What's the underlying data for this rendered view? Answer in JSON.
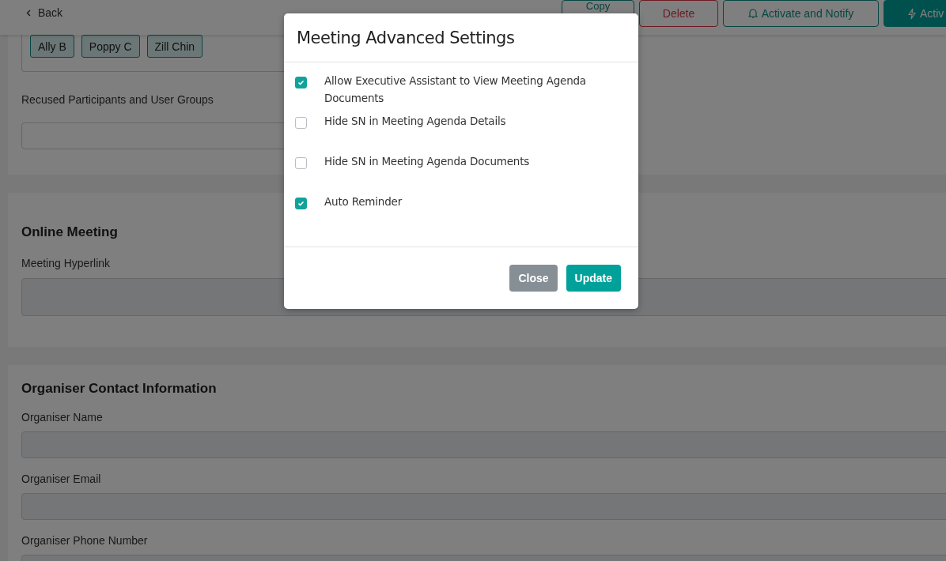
{
  "header": {
    "back": "Back",
    "actions": [
      {
        "label": "Copy",
        "kind": "outline"
      },
      {
        "label": "Delete",
        "kind": "danger"
      },
      {
        "label": "Activate and Notify",
        "kind": "notify"
      },
      {
        "label": "Activ",
        "kind": "activate"
      }
    ]
  },
  "participants": {
    "chips": [
      "Ally B",
      "Poppy C",
      "Zill Chin"
    ]
  },
  "recused": {
    "label": "Recused Participants and User Groups"
  },
  "sections": [
    {
      "title": "Online Meeting",
      "fields": [
        {
          "label": "Meeting Hyperlink",
          "kind": "textarea"
        }
      ]
    },
    {
      "title": "Organiser Contact Information",
      "fields": [
        {
          "label": "Organiser Name",
          "kind": "input"
        },
        {
          "label": "Organiser Email",
          "kind": "input"
        },
        {
          "label": "Organiser Phone Number",
          "kind": "input"
        }
      ]
    }
  ],
  "modal": {
    "title": "Meeting Advanced Settings",
    "options": [
      {
        "label": "Allow Executive Assistant to View Meeting Agenda Documents",
        "checked": true
      },
      {
        "label": "Hide SN in Meeting Agenda Details",
        "checked": false
      },
      {
        "label": "Hide SN in Meeting Agenda Documents",
        "checked": false
      },
      {
        "label": "Auto Reminder",
        "checked": true
      }
    ],
    "buttons": [
      {
        "label": "Close",
        "kind": "secondary"
      },
      {
        "label": "Update",
        "kind": "primary"
      }
    ]
  }
}
